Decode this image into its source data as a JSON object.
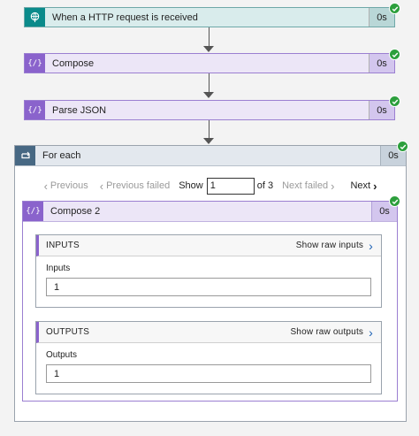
{
  "flow": {
    "http_trigger": {
      "title": "When a HTTP request is received",
      "duration": "0s",
      "icon": "http-globe-icon",
      "color": "#0a8a8a"
    },
    "compose": {
      "title": "Compose",
      "duration": "0s",
      "icon": "code-braces-icon",
      "color": "#8a63cc"
    },
    "parse_json": {
      "title": "Parse JSON",
      "duration": "0s",
      "icon": "code-braces-icon",
      "color": "#8a63cc"
    },
    "for_each": {
      "title": "For each",
      "duration": "0s",
      "icon": "loop-icon",
      "color": "#476883",
      "pager": {
        "previous": "Previous",
        "previous_failed": "Previous failed",
        "show": "Show",
        "current": "1",
        "of_total": "of 3",
        "next_failed": "Next failed",
        "next": "Next"
      },
      "compose2": {
        "title": "Compose 2",
        "duration": "0s",
        "inputs": {
          "header": "INPUTS",
          "raw_link": "Show raw inputs",
          "field_label": "Inputs",
          "field_value": "1"
        },
        "outputs": {
          "header": "OUTPUTS",
          "raw_link": "Show raw outputs",
          "field_label": "Outputs",
          "field_value": "1"
        }
      }
    },
    "status_color": "#2c9f3c"
  }
}
